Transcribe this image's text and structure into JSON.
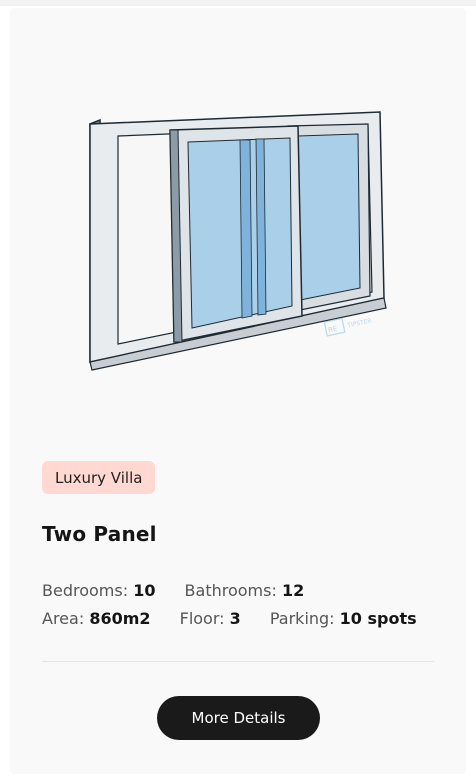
{
  "card": {
    "badge": "Luxury Villa",
    "title": "Two Panel",
    "specs": {
      "bedrooms_label": "Bedrooms:",
      "bedrooms_value": "10",
      "bathrooms_label": "Bathrooms:",
      "bathrooms_value": "12",
      "area_label": "Area:",
      "area_value": "860m2",
      "floor_label": "Floor:",
      "floor_value": "3",
      "parking_label": "Parking:",
      "parking_value": "10 spots"
    },
    "button_label": "More Details",
    "image": {
      "icon": "sliding-window-icon",
      "watermark": "RE TIPSTER"
    }
  },
  "colors": {
    "card_bg": "#f9f9f9",
    "badge_bg": "#ffd9d1",
    "button_bg": "#1a1a1a",
    "glass": "#a9cfe9",
    "frame": "#7b8d9a"
  }
}
